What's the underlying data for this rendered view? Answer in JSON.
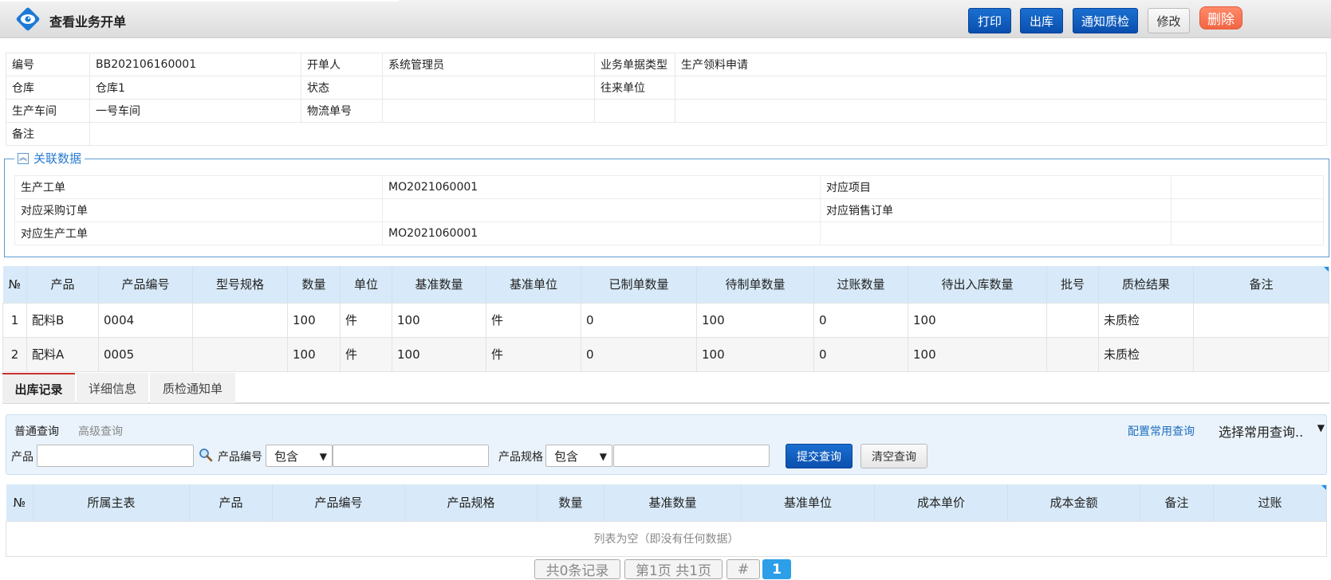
{
  "header": {
    "title": "查看业务开单",
    "buttons": {
      "print": "打印",
      "outbound": "出库",
      "notify_qc": "通知质检",
      "edit": "修改",
      "delete": "删除"
    }
  },
  "info": {
    "rows": [
      [
        "编号",
        "BB202106160001",
        "开单人",
        "系统管理员",
        "业务单据类型",
        "生产领料申请"
      ],
      [
        "仓库",
        "仓库1",
        "状态",
        "",
        "往来单位",
        ""
      ],
      [
        "生产车间",
        "一号车间",
        "物流单号",
        "",
        "",
        ""
      ],
      [
        "备注",
        "",
        "",
        "",
        "",
        ""
      ]
    ]
  },
  "related": {
    "legend": "关联数据",
    "rows": [
      [
        "生产工单",
        "MO2021060001",
        "对应项目",
        ""
      ],
      [
        "对应采购订单",
        "",
        "对应销售订单",
        ""
      ],
      [
        "对应生产工单",
        "MO2021060001",
        "",
        ""
      ]
    ]
  },
  "grid": {
    "columns": [
      "№",
      "产品",
      "产品编号",
      "型号规格",
      "数量",
      "单位",
      "基准数量",
      "基准单位",
      "已制单数量",
      "待制单数量",
      "过账数量",
      "待出入库数量",
      "批号",
      "质检结果",
      "备注"
    ],
    "rows": [
      [
        "1",
        "配料B",
        "0004",
        "",
        "100",
        "件",
        "100",
        "件",
        "0",
        "100",
        "0",
        "100",
        "",
        "未质检",
        ""
      ],
      [
        "2",
        "配料A",
        "0005",
        "",
        "100",
        "件",
        "100",
        "件",
        "0",
        "100",
        "0",
        "100",
        "",
        "未质检",
        ""
      ]
    ]
  },
  "tabs": [
    "出库记录",
    "详细信息",
    "质检通知单"
  ],
  "query": {
    "normal": "普通查询",
    "advanced": "高级查询",
    "config": "配置常用查询",
    "select_common": "选择常用查询..",
    "product_label": "产品",
    "code_label": "产品编号",
    "code_op": "包含",
    "spec_label": "产品规格",
    "spec_op": "包含",
    "submit": "提交查询",
    "clear": "清空查询"
  },
  "records": {
    "columns": [
      "№",
      "所属主表",
      "产品",
      "产品编号",
      "产品规格",
      "数量",
      "基准数量",
      "基准单位",
      "成本单价",
      "成本金额",
      "备注",
      "过账"
    ],
    "empty": "列表为空（即没有任何数据）"
  },
  "pager": {
    "total": "共0条记录",
    "page": "第1页 共1页",
    "hash": "#",
    "current": "1"
  }
}
